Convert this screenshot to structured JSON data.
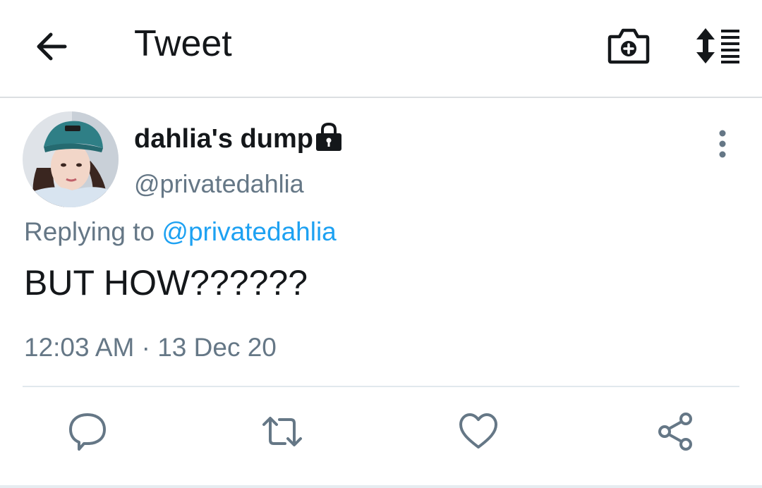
{
  "header": {
    "title": "Tweet",
    "icons": [
      "back-arrow-icon",
      "camera-plus-icon",
      "sort-list-icon"
    ]
  },
  "tweet": {
    "display_name": "dahlia's dump",
    "handle": "@privatedahlia",
    "protected": true,
    "reply_prefix": "Replying to ",
    "reply_to": "@privatedahlia",
    "text": "BUT HOW??????",
    "timestamp": "12:03 AM · 13 Dec 20"
  },
  "actions": [
    "reply-icon",
    "retweet-icon",
    "like-icon",
    "share-icon"
  ],
  "colors": {
    "link": "#1da1f2",
    "secondary_text": "#657786",
    "primary_text": "#14171a"
  }
}
